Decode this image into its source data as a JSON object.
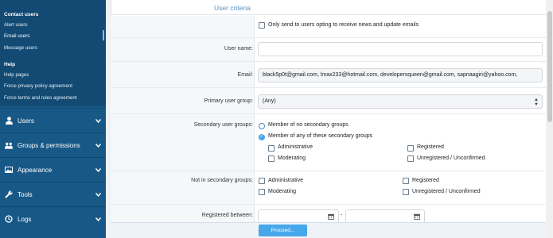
{
  "sidebar": {
    "groups": [
      {
        "heading": "Contact users",
        "items": [
          "Alert users",
          "Email users",
          "Message users"
        ]
      },
      {
        "heading": "Help",
        "items": [
          "Help pages",
          "Force privacy policy agreement",
          "Force terms and rules agreement"
        ]
      }
    ],
    "sections": [
      {
        "label": "Users",
        "icon": "user-icon"
      },
      {
        "label": "Groups & permissions",
        "icon": "users-icon"
      },
      {
        "label": "Appearance",
        "icon": "image-icon"
      },
      {
        "label": "Tools",
        "icon": "wrench-icon"
      },
      {
        "label": "Logs",
        "icon": "history-icon"
      }
    ]
  },
  "form": {
    "section_title": "User criteria",
    "newsletter_option": "Only send to users opting to receive news and update emails",
    "username_label": "User name:",
    "username_value": "",
    "email_label": "Email:",
    "email_value": "black5p0t@gmail.com, lmax233@hotmail.com, developersqueen@gmail.com, sapnaagiri@yahoo.com,",
    "primary_group_label": "Primary user group:",
    "primary_group_value": "(Any)",
    "secondary_label": "Secondary user groups:",
    "secondary_radio_none": "Member of no secondary groups",
    "secondary_radio_any": "Member of any of these secondary groups",
    "groups": [
      "Administrative",
      "Registered",
      "Moderating",
      "Unregistered / Unconfirmed"
    ],
    "not_in_label": "Not in secondary groups:",
    "registered_label": "Registered between:",
    "range_separator": "-",
    "proceed_label": "Proceed..."
  },
  "colors": {
    "sidebar_bg": "#185886",
    "sidebar_sub_bg": "#124a73",
    "accent": "#47a7eb",
    "title": "#5b8fbd"
  }
}
